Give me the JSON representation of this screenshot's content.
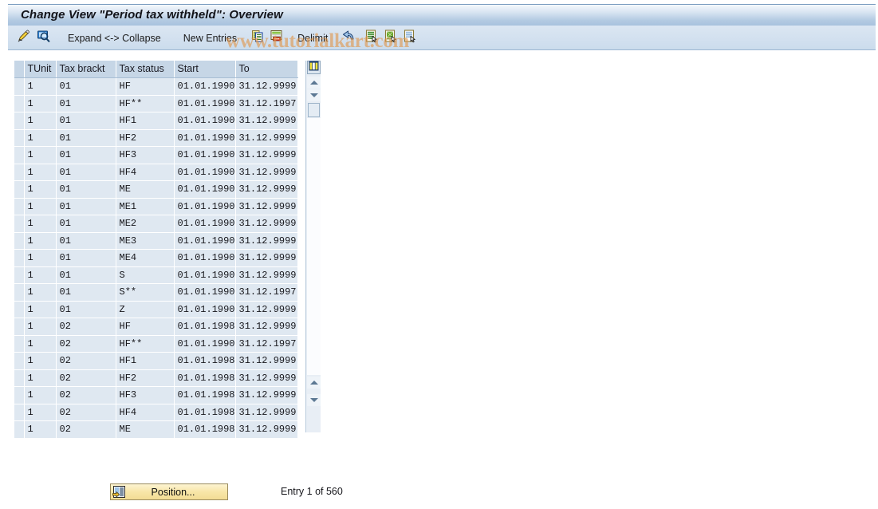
{
  "window": {
    "title": "Change View \"Period tax withheld\": Overview"
  },
  "toolbar": {
    "icons_left": [
      {
        "name": "display-change-icon",
        "label": ""
      },
      {
        "name": "details-magnifier-icon",
        "label": ""
      }
    ],
    "expand_collapse_label": "Expand <-> Collapse",
    "new_entries_label": "New Entries",
    "delimit_label": "Delimit",
    "icons_right": [
      {
        "name": "copy-icon"
      },
      {
        "name": "delete-row-icon"
      },
      {
        "name": "undo-icon"
      },
      {
        "name": "select-all-icon"
      },
      {
        "name": "deselect-all-icon"
      },
      {
        "name": "select-block-icon"
      }
    ]
  },
  "watermark": {
    "text": "www.tutorialkart.com"
  },
  "table": {
    "columns": [
      "TUnit",
      "Tax brackt",
      "Tax status",
      "Start",
      "To"
    ],
    "settings_icon": "table-settings-icon",
    "rows": [
      {
        "tunit": "1",
        "brackt": "01",
        "status": "HF",
        "start": "01.01.1990",
        "to": "31.12.9999"
      },
      {
        "tunit": "1",
        "brackt": "01",
        "status": "HF**",
        "start": "01.01.1990",
        "to": "31.12.1997"
      },
      {
        "tunit": "1",
        "brackt": "01",
        "status": "HF1",
        "start": "01.01.1990",
        "to": "31.12.9999"
      },
      {
        "tunit": "1",
        "brackt": "01",
        "status": "HF2",
        "start": "01.01.1990",
        "to": "31.12.9999"
      },
      {
        "tunit": "1",
        "brackt": "01",
        "status": "HF3",
        "start": "01.01.1990",
        "to": "31.12.9999"
      },
      {
        "tunit": "1",
        "brackt": "01",
        "status": "HF4",
        "start": "01.01.1990",
        "to": "31.12.9999"
      },
      {
        "tunit": "1",
        "brackt": "01",
        "status": "ME",
        "start": "01.01.1990",
        "to": "31.12.9999"
      },
      {
        "tunit": "1",
        "brackt": "01",
        "status": "ME1",
        "start": "01.01.1990",
        "to": "31.12.9999"
      },
      {
        "tunit": "1",
        "brackt": "01",
        "status": "ME2",
        "start": "01.01.1990",
        "to": "31.12.9999"
      },
      {
        "tunit": "1",
        "brackt": "01",
        "status": "ME3",
        "start": "01.01.1990",
        "to": "31.12.9999"
      },
      {
        "tunit": "1",
        "brackt": "01",
        "status": "ME4",
        "start": "01.01.1990",
        "to": "31.12.9999"
      },
      {
        "tunit": "1",
        "brackt": "01",
        "status": "S",
        "start": "01.01.1990",
        "to": "31.12.9999"
      },
      {
        "tunit": "1",
        "brackt": "01",
        "status": "S**",
        "start": "01.01.1990",
        "to": "31.12.1997"
      },
      {
        "tunit": "1",
        "brackt": "01",
        "status": "Z",
        "start": "01.01.1990",
        "to": "31.12.9999"
      },
      {
        "tunit": "1",
        "brackt": "02",
        "status": "HF",
        "start": "01.01.1998",
        "to": "31.12.9999"
      },
      {
        "tunit": "1",
        "brackt": "02",
        "status": "HF**",
        "start": "01.01.1990",
        "to": "31.12.1997"
      },
      {
        "tunit": "1",
        "brackt": "02",
        "status": "HF1",
        "start": "01.01.1998",
        "to": "31.12.9999"
      },
      {
        "tunit": "1",
        "brackt": "02",
        "status": "HF2",
        "start": "01.01.1998",
        "to": "31.12.9999"
      },
      {
        "tunit": "1",
        "brackt": "02",
        "status": "HF3",
        "start": "01.01.1998",
        "to": "31.12.9999"
      },
      {
        "tunit": "1",
        "brackt": "02",
        "status": "HF4",
        "start": "01.01.1998",
        "to": "31.12.9999"
      },
      {
        "tunit": "1",
        "brackt": "02",
        "status": "ME",
        "start": "01.01.1998",
        "to": "31.12.9999"
      }
    ]
  },
  "footer": {
    "position_label": "Position...",
    "position_icon": "position-goto-icon",
    "entry_count": "Entry 1 of 560"
  },
  "colors": {
    "title_gradient_start": "#f4f8fc",
    "title_gradient_end": "#a8c2de",
    "header_cell": "#c6d6e6",
    "data_cell": "#dfe8f1",
    "button_yellow": "#f2dc94",
    "watermark": "#e0964a"
  }
}
